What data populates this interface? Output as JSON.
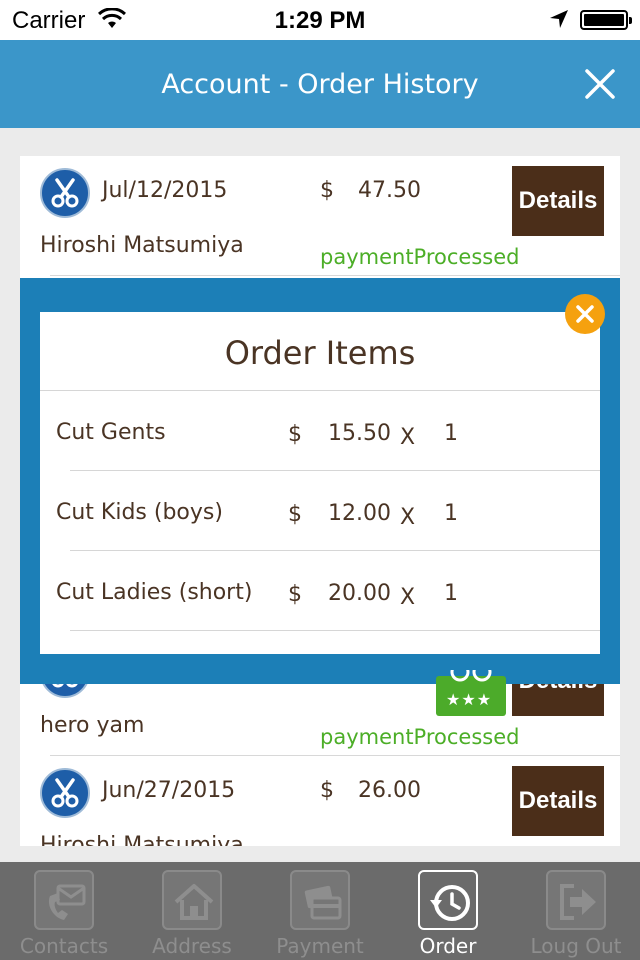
{
  "status_bar": {
    "carrier": "Carrier",
    "time": "1:29 PM"
  },
  "header": {
    "title": "Account - Order History"
  },
  "orders": [
    {
      "date": "Jul/12/2015",
      "currency": "$",
      "amount": "47.50",
      "customer": "Hiroshi Matsumiya",
      "status": "paymentProcessed",
      "details_label": "Details"
    },
    {
      "date": "",
      "currency": "",
      "amount": "",
      "customer": "hero yam",
      "status": "paymentProcessed",
      "details_label": "Details"
    },
    {
      "date": "Jun/27/2015",
      "currency": "$",
      "amount": "26.00",
      "customer": "Hiroshi Matsumiya",
      "status": "",
      "details_label": "Details"
    }
  ],
  "modal": {
    "title": "Order Items",
    "items": [
      {
        "name": "Cut Gents",
        "currency": "$",
        "price": "15.50",
        "times": "X",
        "qty": "1"
      },
      {
        "name": "Cut Kids (boys)",
        "currency": "$",
        "price": "12.00",
        "times": "X",
        "qty": "1"
      },
      {
        "name": "Cut Ladies (short)",
        "currency": "$",
        "price": "20.00",
        "times": "X",
        "qty": "1"
      }
    ]
  },
  "tabs": [
    {
      "label": "Contacts",
      "icon": "contacts-icon",
      "active": false
    },
    {
      "label": "Address",
      "icon": "home-icon",
      "active": false
    },
    {
      "label": "Payment",
      "icon": "credit-card-icon",
      "active": false
    },
    {
      "label": "Order",
      "icon": "order-history-icon",
      "active": true
    },
    {
      "label": "Loug Out",
      "icon": "logout-icon",
      "active": false
    }
  ],
  "colors": {
    "nav": "#3b96c9",
    "modal_frame": "#1c7fb7",
    "details_button": "#4b2e19",
    "status_text": "#4cae27",
    "close_badge": "#f5a10f"
  }
}
